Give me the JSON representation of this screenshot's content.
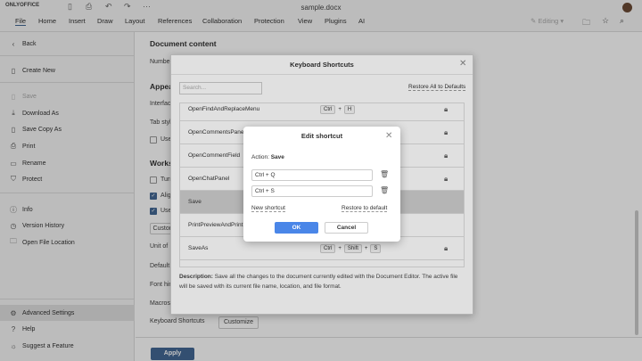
{
  "header": {
    "logo": "ONLYOFFICE",
    "title": "sample.docx",
    "editing": "Editing",
    "tabs": [
      "File",
      "Home",
      "Insert",
      "Draw",
      "Layout",
      "References",
      "Collaboration",
      "Protection",
      "View",
      "Plugins",
      "AI"
    ]
  },
  "sidebar": {
    "items": [
      "Back",
      "Create New",
      "Save",
      "Download As",
      "Save Copy As",
      "Print",
      "Rename",
      "Protect",
      "Info",
      "Version History",
      "Open File Location",
      "Advanced Settings",
      "Help",
      "Suggest a Feature"
    ]
  },
  "main": {
    "doc_content": "Document content",
    "numbering": "Numbering",
    "appearance": "Appearance",
    "interface": "Interface",
    "tab_style": "Tab style",
    "use": "Use",
    "workspace": "Workspace",
    "turn": "Turn",
    "align": "Align",
    "use2": "Use",
    "customize_short": "Customize",
    "unit": "Unit of",
    "default": "Default",
    "font_hinting": "Font hinting",
    "macros": "Macros",
    "keyboard_shortcuts": "Keyboard Shortcuts",
    "customize": "Customize",
    "apply": "Apply"
  },
  "ks_dialog": {
    "title": "Keyboard Shortcuts",
    "search_placeholder": "Search...",
    "restore_all": "Restore All to Defaults",
    "rows": [
      {
        "name": "OpenFindAndReplaceMenu",
        "keys": [
          "Ctrl",
          "H"
        ],
        "locked": true
      },
      {
        "name": "OpenCommentsPanel",
        "keys": [],
        "locked": true
      },
      {
        "name": "OpenCommentField",
        "keys": [],
        "locked": true
      },
      {
        "name": "OpenChatPanel",
        "keys": [],
        "locked": true
      },
      {
        "name": "Save",
        "keys": [],
        "locked": false
      },
      {
        "name": "PrintPreviewAndPrint",
        "keys": [],
        "locked": false
      },
      {
        "name": "SaveAs",
        "keys": [
          "Ctrl",
          "Shift",
          "S"
        ],
        "locked": true
      }
    ],
    "plus": "+",
    "description_label": "Description:",
    "description": " Save all the changes to the document currently edited with the Document Editor. The active file will be saved with its current file name, location, and file format."
  },
  "edit_dialog": {
    "title": "Edit shortcut",
    "action_label": "Action:",
    "action": "Save",
    "shortcuts": [
      "Ctrl + Q",
      "Ctrl + S"
    ],
    "new_shortcut": "New shortcut",
    "restore_default": "Restore to default",
    "ok": "OK",
    "cancel": "Cancel"
  }
}
